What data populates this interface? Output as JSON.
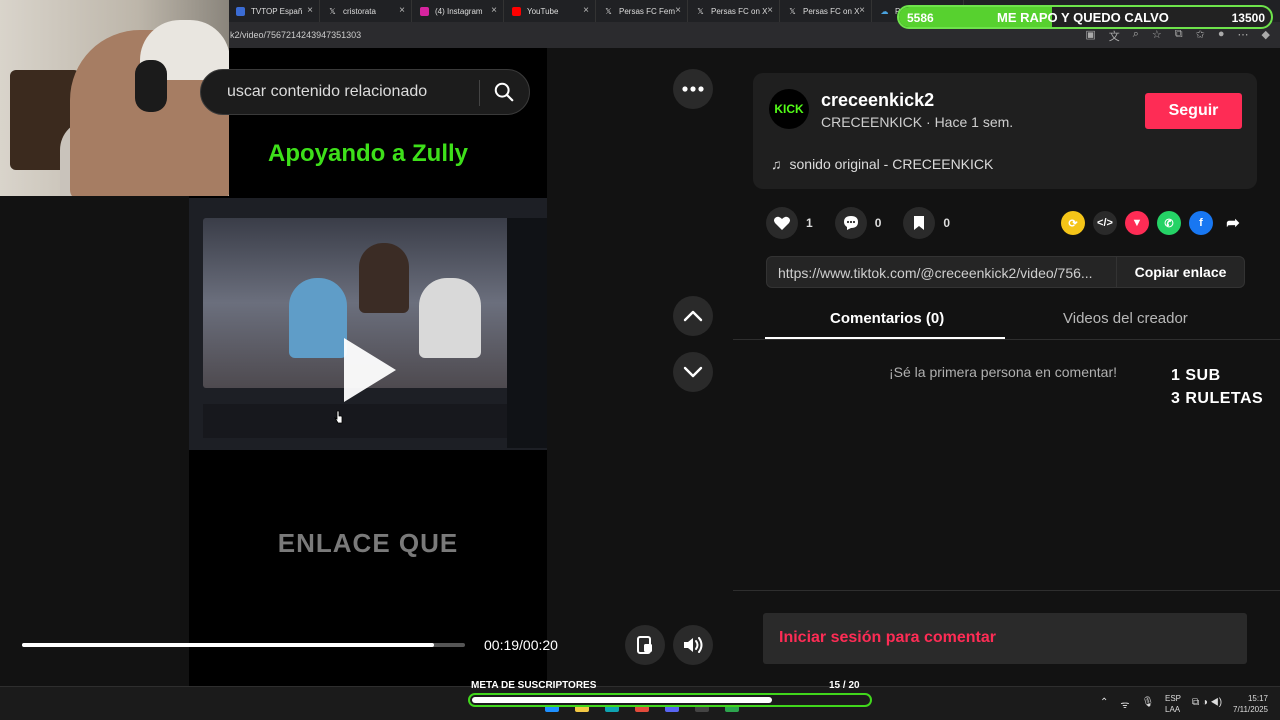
{
  "browser": {
    "tabs": [
      {
        "label": "TVTOP Españ",
        "icon": "tvtop-icon",
        "icon_color": "#3b6cd4"
      },
      {
        "label": "cristorata",
        "icon": "x-icon",
        "icon_color": "#ffffff"
      },
      {
        "label": "(4) Instagram",
        "icon": "instagram-icon",
        "icon_color": "#d6249f"
      },
      {
        "label": "YouTube",
        "icon": "youtube-icon",
        "icon_color": "#ff0000"
      },
      {
        "label": "Persas FC Fem",
        "icon": "x-icon",
        "icon_color": "#ffffff"
      },
      {
        "label": "Persas FC on X",
        "icon": "x-icon",
        "icon_color": "#ffffff"
      },
      {
        "label": "Persas FC on X",
        "icon": "x-icon",
        "icon_color": "#ffffff"
      },
      {
        "label": "Part",
        "icon": "cloud-icon",
        "icon_color": "#4aa3e0"
      }
    ],
    "address": "k2/video/7567214243947351303"
  },
  "stream_overlay": {
    "top_goal": {
      "left": "5586",
      "title": "ME RAPO Y QUEDO CALVO",
      "right": "13500",
      "progress": 0.41
    },
    "side_text_1": "1 SUB",
    "side_text_2": "3 RULETAS",
    "meta_label": "META DE SUSCRIPTORES",
    "meta_count": "15  / 20",
    "meta_progress": 0.75
  },
  "video": {
    "search_placeholder": "uscar contenido relacionado",
    "title_overlay": "Apoyando a Zully",
    "bottom_overlay": "ENLACE QUE",
    "time": "00:19/00:20",
    "progress": 0.93
  },
  "creator": {
    "avatar_text": "KICK",
    "username": "creceenkick2",
    "subline": "CRECEENKICK · Hace 1 sem.",
    "follow_label": "Seguir",
    "sound": "sonido original - CRECEENKICK"
  },
  "stats": {
    "likes": "1",
    "comments": "0",
    "saves": "0"
  },
  "share": {
    "url": "https://www.tiktok.com/@creceenkick2/video/756...",
    "copy_label": "Copiar enlace"
  },
  "tabs": {
    "comments": "Comentarios (0)",
    "creator_videos": "Videos del creador"
  },
  "comments": {
    "empty": "¡Sé la primera persona en comentar!",
    "login_prompt": "Iniciar sesión para comentar"
  },
  "taskbar": {
    "lang": "ESP",
    "lang2": "LAA",
    "time": "15:17",
    "date": "7/11/2025"
  },
  "colors": {
    "accent": "#fe2c55",
    "kick_green": "#53fc18",
    "overlay_green": "#3ee01a"
  }
}
